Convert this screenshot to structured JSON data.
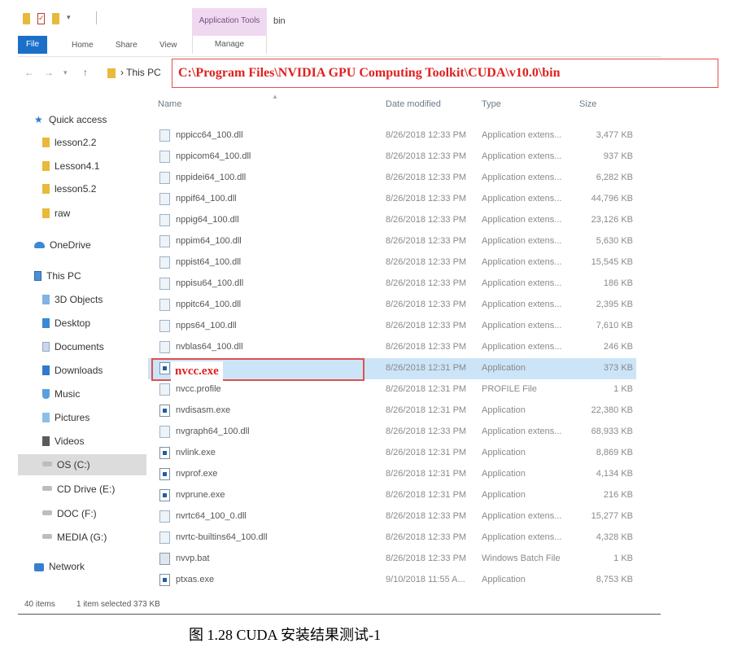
{
  "window": {
    "title": "bin",
    "contextual_tab_group": "Application Tools"
  },
  "ribbon": {
    "tabs": [
      "File",
      "Home",
      "Share",
      "View"
    ],
    "contextual_tab": "Manage"
  },
  "address_bar": {
    "crumb": "This PC",
    "path_callout": "C:\\Program Files\\NVIDIA GPU Computing Toolkit\\CUDA\\v10.0\\bin"
  },
  "nav_pane": {
    "items": [
      {
        "label": "Quick access",
        "icon": "star-icon"
      },
      {
        "label": "lesson2.2",
        "icon": "folder-icon"
      },
      {
        "label": "Lesson4.1",
        "icon": "folder-icon"
      },
      {
        "label": "lesson5.2",
        "icon": "folder-icon"
      },
      {
        "label": "raw",
        "icon": "folder-icon"
      },
      {
        "label": "OneDrive",
        "icon": "cloud-icon"
      },
      {
        "label": "This PC",
        "icon": "computer-icon"
      },
      {
        "label": "3D Objects",
        "icon": "cube-icon"
      },
      {
        "label": "Desktop",
        "icon": "desktop-icon"
      },
      {
        "label": "Documents",
        "icon": "documents-icon"
      },
      {
        "label": "Downloads",
        "icon": "downloads-icon"
      },
      {
        "label": "Music",
        "icon": "music-icon"
      },
      {
        "label": "Pictures",
        "icon": "pictures-icon"
      },
      {
        "label": "Videos",
        "icon": "videos-icon"
      },
      {
        "label": "OS (C:)",
        "icon": "drive-icon"
      },
      {
        "label": "CD Drive (E:)",
        "icon": "cd-drive-icon"
      },
      {
        "label": "DOC (F:)",
        "icon": "drive-icon"
      },
      {
        "label": "MEDIA (G:)",
        "icon": "drive-icon"
      },
      {
        "label": "Network",
        "icon": "network-icon"
      }
    ]
  },
  "file_list": {
    "columns": [
      "Name",
      "Date modified",
      "Type",
      "Size"
    ],
    "rows": [
      {
        "name": "nppicc64_100.dll",
        "date": "8/26/2018 12:33 PM",
        "type": "Application extens...",
        "size": "3,477 KB",
        "icon": "dll-icon"
      },
      {
        "name": "nppicom64_100.dll",
        "date": "8/26/2018 12:33 PM",
        "type": "Application extens...",
        "size": "937 KB",
        "icon": "dll-icon"
      },
      {
        "name": "nppidei64_100.dll",
        "date": "8/26/2018 12:33 PM",
        "type": "Application extens...",
        "size": "6,282 KB",
        "icon": "dll-icon"
      },
      {
        "name": "nppif64_100.dll",
        "date": "8/26/2018 12:33 PM",
        "type": "Application extens...",
        "size": "44,796 KB",
        "icon": "dll-icon"
      },
      {
        "name": "nppig64_100.dll",
        "date": "8/26/2018 12:33 PM",
        "type": "Application extens...",
        "size": "23,126 KB",
        "icon": "dll-icon"
      },
      {
        "name": "nppim64_100.dll",
        "date": "8/26/2018 12:33 PM",
        "type": "Application extens...",
        "size": "5,630 KB",
        "icon": "dll-icon"
      },
      {
        "name": "nppist64_100.dll",
        "date": "8/26/2018 12:33 PM",
        "type": "Application extens...",
        "size": "15,545 KB",
        "icon": "dll-icon"
      },
      {
        "name": "nppisu64_100.dll",
        "date": "8/26/2018 12:33 PM",
        "type": "Application extens...",
        "size": "186 KB",
        "icon": "dll-icon"
      },
      {
        "name": "nppitc64_100.dll",
        "date": "8/26/2018 12:33 PM",
        "type": "Application extens...",
        "size": "2,395 KB",
        "icon": "dll-icon"
      },
      {
        "name": "npps64_100.dll",
        "date": "8/26/2018 12:33 PM",
        "type": "Application extens...",
        "size": "7,610 KB",
        "icon": "dll-icon"
      },
      {
        "name": "nvblas64_100.dll",
        "date": "8/26/2018 12:33 PM",
        "type": "Application extens...",
        "size": "246 KB",
        "icon": "dll-icon"
      },
      {
        "name": "nvcc.exe",
        "date": "8/26/2018 12:31 PM",
        "type": "Application",
        "size": "373 KB",
        "icon": "exe-icon",
        "selected": true
      },
      {
        "name": "nvcc.profile",
        "date": "8/26/2018 12:31 PM",
        "type": "PROFILE File",
        "size": "1 KB",
        "icon": "file-icon"
      },
      {
        "name": "nvdisasm.exe",
        "date": "8/26/2018 12:31 PM",
        "type": "Application",
        "size": "22,380 KB",
        "icon": "exe-icon"
      },
      {
        "name": "nvgraph64_100.dll",
        "date": "8/26/2018 12:33 PM",
        "type": "Application extens...",
        "size": "68,933 KB",
        "icon": "dll-icon"
      },
      {
        "name": "nvlink.exe",
        "date": "8/26/2018 12:31 PM",
        "type": "Application",
        "size": "8,869 KB",
        "icon": "exe-icon"
      },
      {
        "name": "nvprof.exe",
        "date": "8/26/2018 12:31 PM",
        "type": "Application",
        "size": "4,134 KB",
        "icon": "exe-icon"
      },
      {
        "name": "nvprune.exe",
        "date": "8/26/2018 12:31 PM",
        "type": "Application",
        "size": "216 KB",
        "icon": "exe-icon"
      },
      {
        "name": "nvrtc64_100_0.dll",
        "date": "8/26/2018 12:33 PM",
        "type": "Application extens...",
        "size": "15,277 KB",
        "icon": "dll-icon"
      },
      {
        "name": "nvrtc-builtins64_100.dll",
        "date": "8/26/2018 12:33 PM",
        "type": "Application extens...",
        "size": "4,328 KB",
        "icon": "dll-icon"
      },
      {
        "name": "nvvp.bat",
        "date": "8/26/2018 12:33 PM",
        "type": "Windows Batch File",
        "size": "1 KB",
        "icon": "bat-icon"
      },
      {
        "name": "ptxas.exe",
        "date": "9/10/2018 11:55 A...",
        "type": "Application",
        "size": "8,753 KB",
        "icon": "exe-icon"
      }
    ],
    "selected_callout": "nvcc.exe"
  },
  "status_bar": {
    "item_count": "40 items",
    "selection": "1 item selected  373 KB"
  },
  "caption": "图  1.28 CUDA 安装结果测试-1",
  "colors": {
    "accent": "#1a6fc9",
    "callout_red": "#e02020",
    "selection": "#cce4f7",
    "contextual_tab": "#efd9f0"
  }
}
